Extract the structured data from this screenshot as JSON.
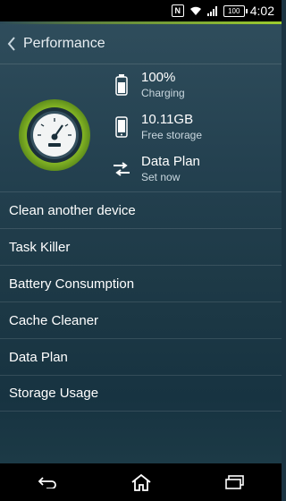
{
  "status_bar": {
    "nfc_label": "N",
    "battery_level": "100",
    "time": "4:02",
    "icons": [
      "nfc-icon",
      "wifi-icon",
      "signal-icon",
      "battery-icon"
    ]
  },
  "header": {
    "title": "Performance",
    "back_icon": "chevron-left-icon"
  },
  "summary": {
    "gauge_icon": "speedometer-icon",
    "stats": [
      {
        "icon": "battery-icon",
        "value": "100%",
        "label": "Charging"
      },
      {
        "icon": "phone-icon",
        "value": "10.11GB",
        "label": "Free storage"
      },
      {
        "icon": "transfer-arrows-icon",
        "value": "Data Plan",
        "label": "Set now"
      }
    ]
  },
  "menu": {
    "items": [
      {
        "label": "Clean another device"
      },
      {
        "label": "Task Killer"
      },
      {
        "label": "Battery Consumption"
      },
      {
        "label": "Cache Cleaner"
      },
      {
        "label": "Data Plan"
      },
      {
        "label": "Storage Usage"
      }
    ]
  },
  "nav_bar": {
    "icons": [
      "back-icon",
      "home-icon",
      "recent-apps-icon"
    ]
  },
  "colors": {
    "accent": "#9ccc2e",
    "background": "#1f3b49",
    "text": "#ffffff",
    "subtext": "#c9d7df"
  }
}
